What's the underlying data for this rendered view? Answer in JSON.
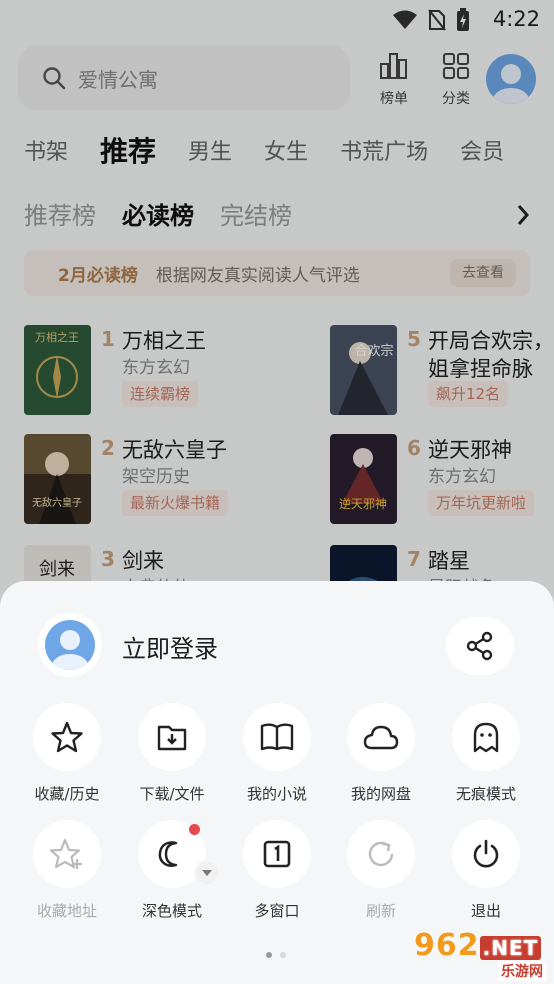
{
  "status": {
    "time": "4:22"
  },
  "search": {
    "placeholder": "爱情公寓"
  },
  "top_buttons": {
    "rank": "榜单",
    "category": "分类"
  },
  "main_tabs": [
    "书架",
    "推荐",
    "男生",
    "女生",
    "书荒广场",
    "会员"
  ],
  "rank_tabs": [
    "推荐榜",
    "必读榜",
    "完结榜"
  ],
  "banner": {
    "title": "2月必读榜",
    "desc": "根据网友真实阅读人气评选",
    "action": "去查看"
  },
  "books_left": [
    {
      "rank": "1",
      "title": "万相之王",
      "genre": "东方玄幻",
      "tag": "连续霸榜",
      "cover_text": "万相之王"
    },
    {
      "rank": "2",
      "title": "无敌六皇子",
      "genre": "架空历史",
      "tag": "最新火爆书籍",
      "cover_text": "无敌六皇子"
    },
    {
      "rank": "3",
      "title": "剑来",
      "genre": "古典仙侠",
      "cover_text": "剑来"
    }
  ],
  "books_right": [
    {
      "rank": "5",
      "title": "开局合欢宗，被",
      "title2": "姐拿捏命脉",
      "tag": "飙升12名",
      "cover_text": "合欢宗"
    },
    {
      "rank": "6",
      "title": "逆天邪神",
      "genre": "东方玄幻",
      "tag": "万年坑更新啦",
      "cover_text": "逆天邪神"
    },
    {
      "rank": "7",
      "title": "踏星",
      "genre": "星际战争"
    }
  ],
  "sheet": {
    "login": "立即登录",
    "row1": [
      {
        "label": "收藏/历史",
        "icon": "star-icon"
      },
      {
        "label": "下载/文件",
        "icon": "download-folder-icon"
      },
      {
        "label": "我的小说",
        "icon": "book-icon"
      },
      {
        "label": "我的网盘",
        "icon": "cloud-icon"
      },
      {
        "label": "无痕模式",
        "icon": "ghost-icon"
      }
    ],
    "row2": [
      {
        "label": "收藏地址",
        "icon": "star-plus-icon",
        "disabled": true
      },
      {
        "label": "深色模式",
        "icon": "moon-icon"
      },
      {
        "label": "多窗口",
        "icon": "window-icon"
      },
      {
        "label": "刷新",
        "icon": "refresh-icon",
        "disabled": true
      },
      {
        "label": "退出",
        "icon": "power-icon"
      }
    ]
  },
  "watermark": {
    "main": "962",
    "suffix": ".NET",
    "sub": "乐游网"
  }
}
